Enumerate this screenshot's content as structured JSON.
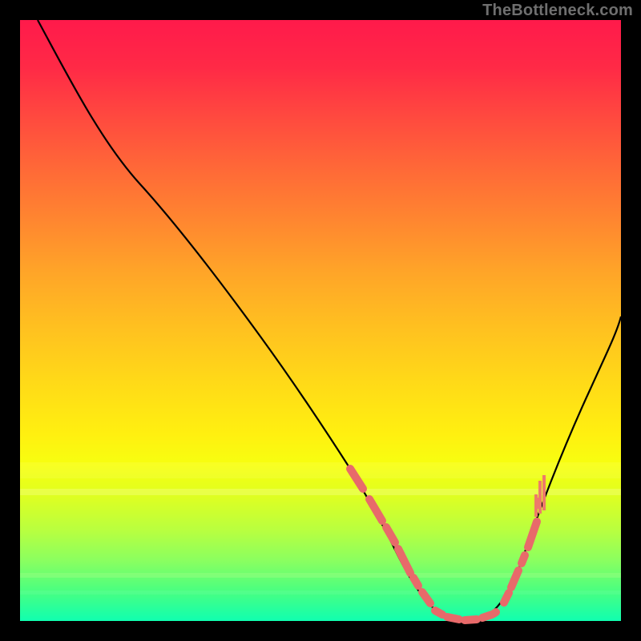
{
  "watermark": "TheBottleneck.com",
  "chart_data": {
    "type": "line",
    "title": "",
    "xlabel": "",
    "ylabel": "",
    "xlim": [
      0,
      100
    ],
    "ylim": [
      0,
      100
    ],
    "grid": false,
    "legend": false,
    "series": [
      {
        "name": "curve",
        "x": [
          3,
          10,
          20,
          30,
          40,
          50,
          55,
          58,
          60,
          63,
          67,
          70,
          75,
          80,
          85,
          90,
          95,
          100
        ],
        "values": [
          100,
          89,
          73,
          58,
          43,
          29,
          22,
          17,
          13,
          8,
          3,
          1,
          0,
          3,
          13,
          25,
          38,
          51
        ]
      }
    ],
    "highlight_segments": {
      "description": "salmon dash overlays on the curve (approx x-ranges)",
      "left_descent": [
        [
          55,
          57.5
        ],
        [
          58.2,
          60.5
        ],
        [
          61,
          62.5
        ],
        [
          63,
          65
        ],
        [
          65.5,
          66.3
        ],
        [
          67,
          68.5
        ]
      ],
      "valley_flat": [
        [
          69,
          70.2
        ],
        [
          71,
          73
        ],
        [
          74,
          76
        ],
        [
          77,
          78.5
        ],
        [
          78.8,
          79.2
        ]
      ],
      "right_ascent": [
        [
          80.5,
          81.3
        ],
        [
          81.8,
          83
        ],
        [
          83.5,
          84
        ],
        [
          84.5,
          86
        ]
      ],
      "torch_flame": {
        "x": 86,
        "y_from": 17,
        "y_to": 27
      }
    },
    "background_gradient": {
      "orientation": "vertical",
      "stops": [
        {
          "pos": 0.0,
          "color": "#ff1a4b"
        },
        {
          "pos": 0.5,
          "color": "#ffc020"
        },
        {
          "pos": 0.74,
          "color": "#f7ff10"
        },
        {
          "pos": 1.0,
          "color": "#10ffb0"
        }
      ]
    }
  }
}
